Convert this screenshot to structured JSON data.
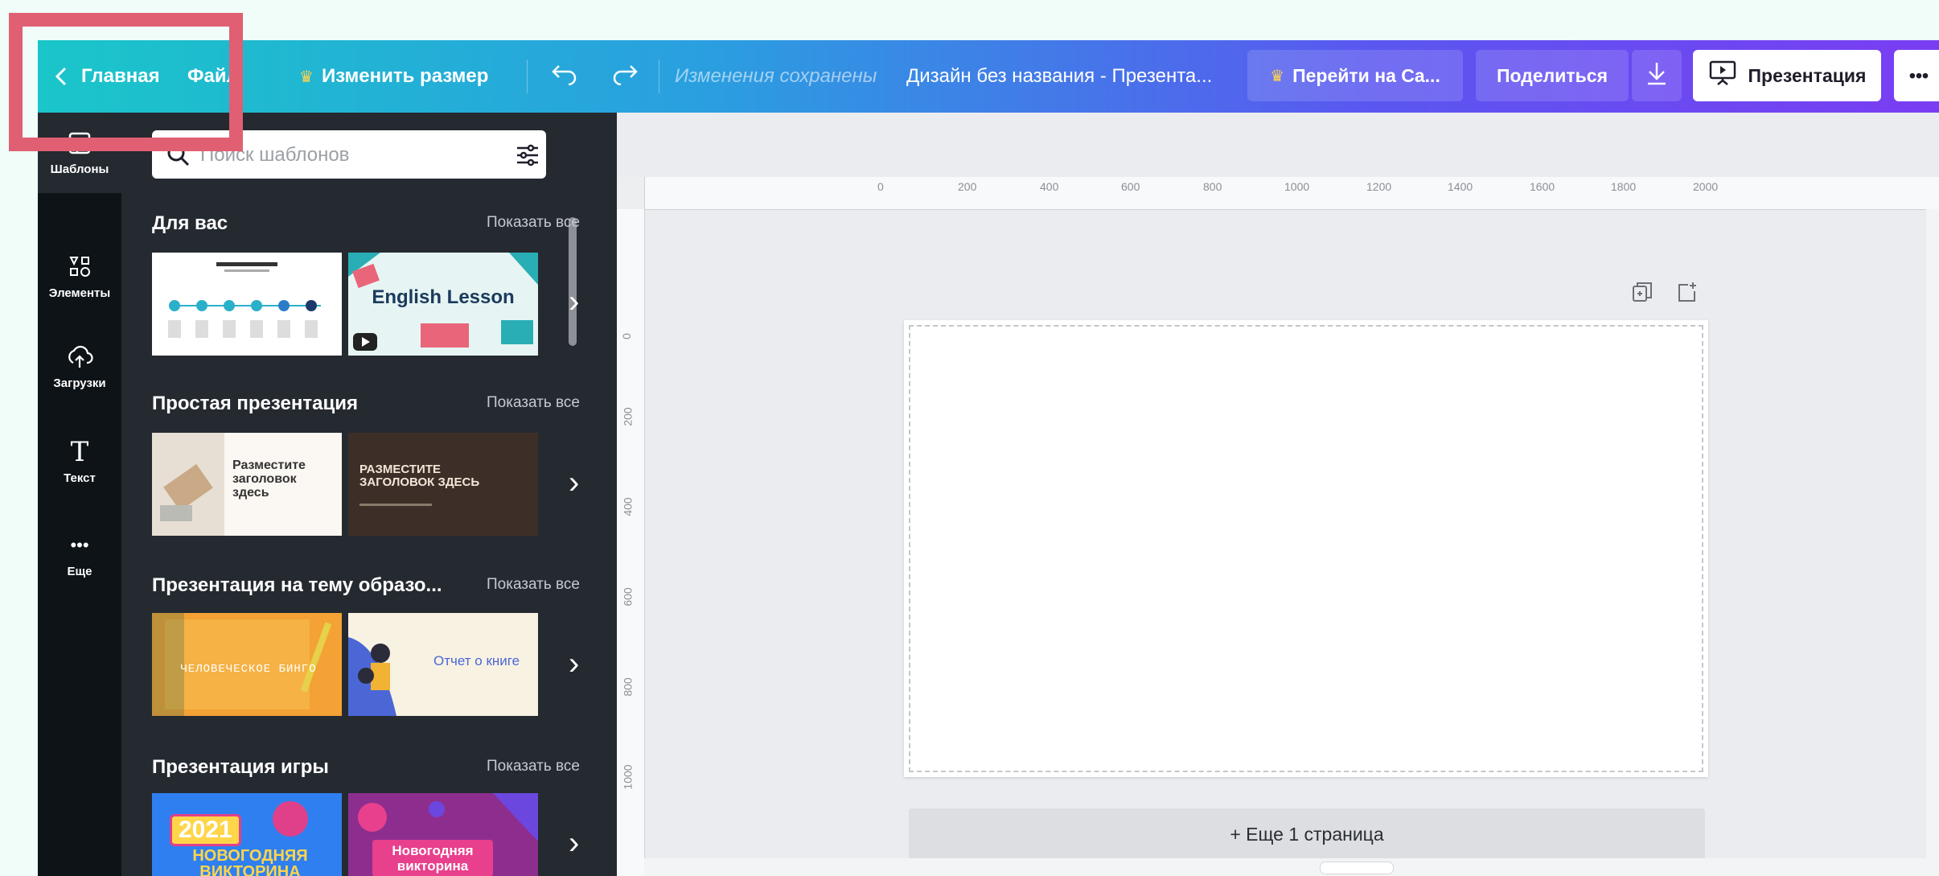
{
  "topbar": {
    "home_label": "Главная",
    "file_label": "Файл",
    "resize_label": "Изменить размер",
    "saved_status": "Изменения сохранены",
    "design_title": "Дизайн без названия - Презента...",
    "pro_label": "Перейти на Ca...",
    "share_label": "Поделиться",
    "present_label": "Презентация",
    "more_label": "•••"
  },
  "rail": {
    "items": [
      {
        "label": "Шаблоны",
        "icon": "templates-icon"
      },
      {
        "label": "Элементы",
        "icon": "elements-icon"
      },
      {
        "label": "Загрузки",
        "icon": "upload-icon"
      },
      {
        "label": "Текст",
        "icon": "text-icon"
      },
      {
        "label": "Еще",
        "icon": "more-dots-icon"
      }
    ]
  },
  "search": {
    "placeholder": "Поиск шаблонов"
  },
  "sections": [
    {
      "title": "Для вас",
      "show_all": "Показать все",
      "thumbs": [
        {
          "text": ""
        },
        {
          "text": "English Lesson"
        }
      ]
    },
    {
      "title": "Простая презентация",
      "show_all": "Показать все",
      "thumbs": [
        {
          "text": "Разместите заголовок здесь"
        },
        {
          "text": "РАЗМЕСТИТЕ ЗАГОЛОВОК ЗДЕСЬ"
        }
      ]
    },
    {
      "title": "Презентация на тему образо...",
      "show_all": "Показать все",
      "thumbs": [
        {
          "text": "ЧЕЛОВЕЧЕСКОЕ БИНГО"
        },
        {
          "text": "Отчет о книге"
        }
      ]
    },
    {
      "title": "Презентация игры",
      "show_all": "Показать все",
      "thumbs": [
        {
          "text": "2021",
          "text2": "НОВОГОДНЯЯ ВИКТОРИНА"
        },
        {
          "text": "Новогодняя викторина"
        }
      ]
    }
  ],
  "ruler": {
    "top_ticks": [
      "0",
      "200",
      "400",
      "600",
      "800",
      "1000",
      "1200",
      "1400",
      "1600",
      "1800",
      "2000"
    ],
    "left_ticks": [
      "0",
      "200",
      "400",
      "600",
      "800",
      "1000"
    ]
  },
  "canvas": {
    "add_page_label": "+ Еще 1 страница"
  },
  "colors": {
    "highlight": "#e05f72",
    "panel": "#252a31",
    "rail": "#0e1318"
  }
}
